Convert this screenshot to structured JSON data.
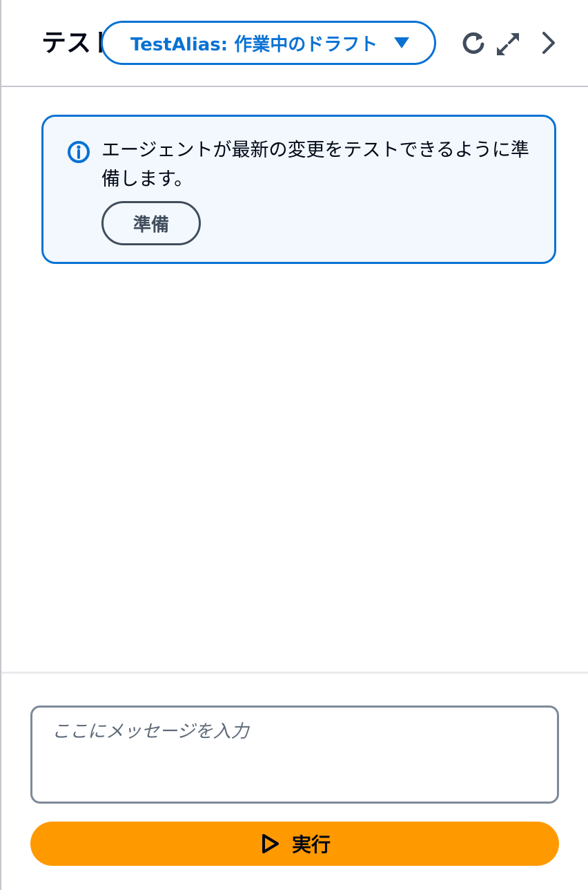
{
  "header": {
    "title": "テスト",
    "alias_selector": "TestAlias: 作業中のドラフト",
    "icons": {
      "refresh": "refresh-icon",
      "expand": "expand-icon",
      "collapse": "chevron-right-icon",
      "caret": "caret-down-icon"
    }
  },
  "alert": {
    "message": "エージェントが最新の変更をテストできるように準備します。",
    "prepare_label": "準備",
    "icon": "info-icon"
  },
  "composer": {
    "placeholder": "ここにメッセージを入力",
    "value": "",
    "run_label": "実行",
    "run_icon": "play-icon"
  },
  "colors": {
    "accent": "#0972d3",
    "alert_bg": "#f2f8fd",
    "primary_button": "#ff9900",
    "border": "#c6c6cd",
    "input_border": "#7d8998"
  }
}
